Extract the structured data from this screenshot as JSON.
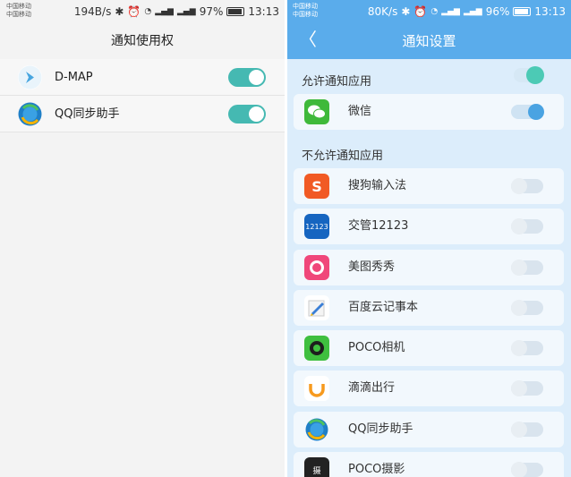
{
  "left": {
    "status": {
      "carrier1": "中国移动",
      "carrier2": "中国移动",
      "speed": "194B/s",
      "battery_pct": "97%",
      "time": "13:13",
      "battery_level": 0.97
    },
    "title": "通知使用权",
    "items": [
      {
        "label": "D-MAP",
        "icon": "d-map-app-icon",
        "enabled": true
      },
      {
        "label": "QQ同步助手",
        "icon": "qq-sync-app-icon",
        "enabled": true
      }
    ],
    "toggle_color": "#45b9b2"
  },
  "right": {
    "status": {
      "carrier1": "中国移动",
      "carrier2": "中国移动",
      "speed": "80K/s",
      "battery_pct": "96%",
      "time": "13:13",
      "battery_level": 0.96
    },
    "title": "通知设置",
    "back_glyph": "〈",
    "allowed_section": "允许通知应用",
    "allowed_apps": [
      {
        "label": "微信",
        "icon": "wechat-app-icon",
        "enabled": true
      }
    ],
    "blocked_section": "不允许通知应用",
    "blocked_apps": [
      {
        "label": "搜狗输入法",
        "icon": "sogou-input-app-icon",
        "enabled": false
      },
      {
        "label": "交管12123",
        "icon": "jiaoguan-12123-app-icon",
        "enabled": false
      },
      {
        "label": "美图秀秀",
        "icon": "meitu-app-icon",
        "enabled": false
      },
      {
        "label": "百度云记事本",
        "icon": "baidu-notepad-app-icon",
        "enabled": false
      },
      {
        "label": "POCO相机",
        "icon": "poco-camera-app-icon",
        "enabled": false
      },
      {
        "label": "滴滴出行",
        "icon": "didi-app-icon",
        "enabled": false
      },
      {
        "label": "QQ同步助手",
        "icon": "qq-sync-app-icon",
        "enabled": false
      },
      {
        "label": "POCO摄影",
        "icon": "poco-photo-app-icon",
        "enabled": false
      }
    ],
    "accent": "#5aaceb",
    "on_color": "#4aa3e2",
    "master_on_color": "#4ccab5"
  }
}
